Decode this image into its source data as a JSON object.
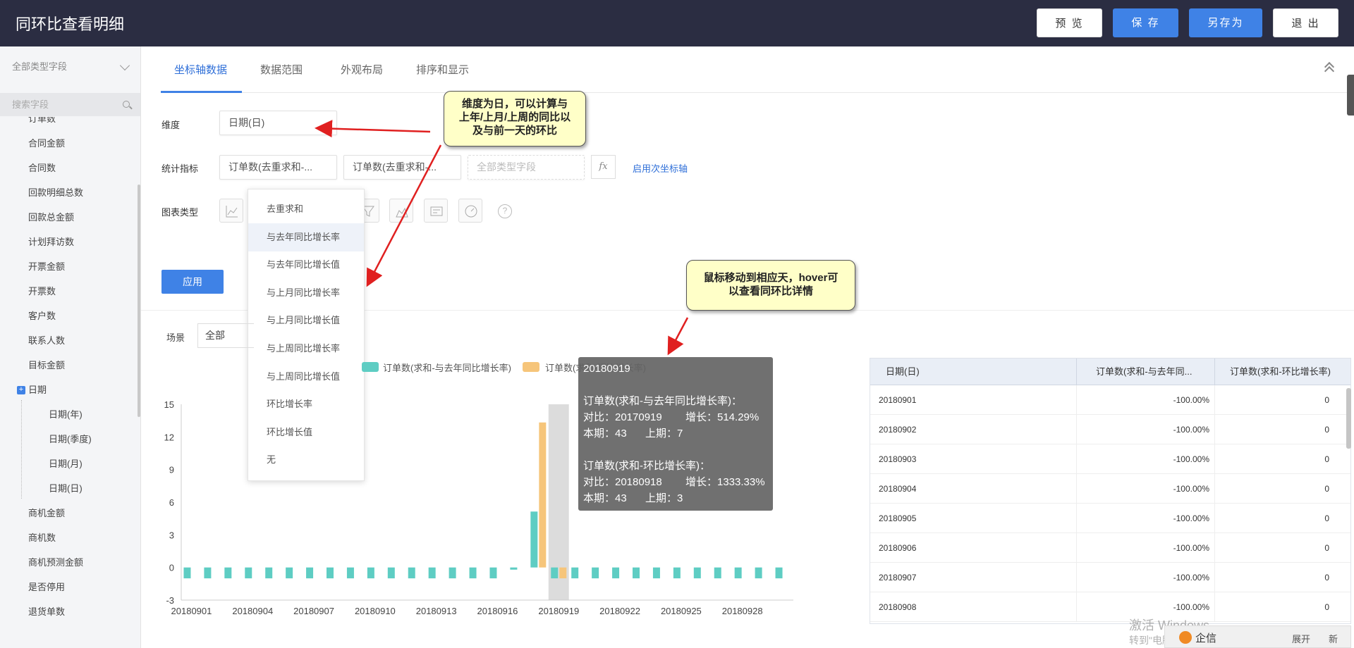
{
  "header": {
    "title": "同环比查看明细",
    "buttons": {
      "preview": "预 览",
      "save": "保 存",
      "save_as": "另存为",
      "exit": "退 出"
    },
    "help_glyph": "?"
  },
  "left_panel": {
    "type_select": "全部类型字段",
    "search_placeholder": "搜索字段",
    "fields": [
      "订单数",
      "合同金额",
      "合同数",
      "回款明细总数",
      "回款总金额",
      "计划拜访数",
      "开票金额",
      "开票数",
      "客户数",
      "联系人数",
      "目标金额"
    ],
    "date_group": "日期",
    "date_children": [
      "日期(年)",
      "日期(季度)",
      "日期(月)",
      "日期(日)"
    ],
    "fields_after": [
      "商机金额",
      "商机数",
      "商机预测金额",
      "是否停用",
      "退货单数"
    ]
  },
  "tabs": [
    "坐标轴数据",
    "数据范围",
    "外观布局",
    "排序和显示"
  ],
  "form": {
    "dimension_label": "维度",
    "dimension_value": "日期(日)",
    "metric_label": "统计指标",
    "metric_1": "订单数(去重求和-...",
    "metric_2": "订单数(去重求和-...",
    "metric_placeholder": "全部类型字段",
    "fx": "fx",
    "secondary_axis_link": "启用次坐标轴",
    "chart_type_label": "图表类型",
    "apply": "应用"
  },
  "dropdown": {
    "items": [
      "去重求和",
      "与去年同比增长率",
      "与去年同比增长值",
      "与上月同比增长率",
      "与上月同比增长值",
      "与上周同比增长率",
      "与上周同比增长值",
      "环比增长率",
      "环比增长值",
      "无"
    ],
    "highlighted_index": 1
  },
  "callouts": {
    "dimension_note": [
      "维度为日，可以计算与",
      "上年/上月/上周的同比以",
      "及与前一天的环比"
    ],
    "hover_note": [
      "鼠标移动到相应天，hover可",
      "以查看同环比详情"
    ]
  },
  "scene": {
    "label": "场景",
    "value": "全部"
  },
  "chart_data": {
    "type": "bar",
    "legend": [
      {
        "name": "订单数(求和-与去年同比增长率)",
        "color": "#5ecdc3"
      },
      {
        "name": "订单数(求和-环比增长率)",
        "color": "#f6c57a"
      }
    ],
    "legend_visible_text": [
      "订单数(求和-与去年同比增长率)",
      "订单数(求和-环比增长率)"
    ],
    "categories": [
      "20180901",
      "20180902",
      "20180903",
      "20180904",
      "20180905",
      "20180906",
      "20180907",
      "20180908",
      "20180909",
      "20180910",
      "20180911",
      "20180912",
      "20180913",
      "20180914",
      "20180915",
      "20180916",
      "20180917",
      "20180918",
      "20180919",
      "20180920",
      "20180921",
      "20180922",
      "20180923",
      "20180924",
      "20180925",
      "20180926",
      "20180927",
      "20180928",
      "20180929",
      "20180930"
    ],
    "x_tick_labels": [
      "20180901",
      "20180904",
      "20180907",
      "20180910",
      "20180913",
      "20180916",
      "20180919",
      "20180922",
      "20180925",
      "20180928"
    ],
    "series": [
      {
        "name": "订单数(求和-与去年同比增长率)",
        "values": [
          -1,
          -1,
          -1,
          -1,
          -1,
          -1,
          -1,
          -1,
          -1,
          -1,
          -1,
          -1,
          -1,
          -1,
          -1,
          -1,
          -0.2,
          5.14,
          -1,
          -1,
          -1,
          -1,
          -1,
          -1,
          -1,
          -1,
          -1,
          -1,
          -1,
          -1
        ]
      },
      {
        "name": "订单数(求和-环比增长率)",
        "values": [
          0,
          0,
          0,
          0,
          0,
          0,
          0,
          0,
          0,
          0,
          0,
          0,
          0,
          0,
          0,
          0,
          0,
          13.33,
          -1,
          0,
          0,
          0,
          0,
          0,
          0,
          0,
          0,
          0,
          0,
          0
        ]
      }
    ],
    "ylim": [
      -3,
      15
    ],
    "yticks": [
      -3,
      0,
      3,
      6,
      9,
      12,
      15
    ],
    "highlight_category": "20180919",
    "grid": false
  },
  "tooltip": {
    "title": "20180919",
    "s1_name": "订单数(求和-与去年同比增长率)：",
    "s1_compare": "对比：20170919",
    "s1_growth": "增长：514.29%",
    "s1_current": "本期：43",
    "s1_prev": "上期：7",
    "s2_name": "订单数(求和-环比增长率)：",
    "s2_compare": "对比：20180918",
    "s2_growth": "增长：1333.33%",
    "s2_current": "本期：43",
    "s2_prev": "上期：3"
  },
  "table": {
    "headers": [
      "日期(日)",
      "订单数(求和-与去年同...",
      "订单数(求和-环比增长率)"
    ],
    "rows": [
      [
        "20180901",
        "-100.00%",
        "0"
      ],
      [
        "20180902",
        "-100.00%",
        "0"
      ],
      [
        "20180903",
        "-100.00%",
        "0"
      ],
      [
        "20180904",
        "-100.00%",
        "0"
      ],
      [
        "20180905",
        "-100.00%",
        "0"
      ],
      [
        "20180906",
        "-100.00%",
        "0"
      ],
      [
        "20180907",
        "-100.00%",
        "0"
      ],
      [
        "20180908",
        "-100.00%",
        "0"
      ]
    ]
  },
  "overlay": {
    "watermark_1": "激活 Windows",
    "watermark_2": "转到\"电脑设置\"以激活 Windows。",
    "chat_label": "企信",
    "expand": "展开",
    "refresh": "新"
  }
}
